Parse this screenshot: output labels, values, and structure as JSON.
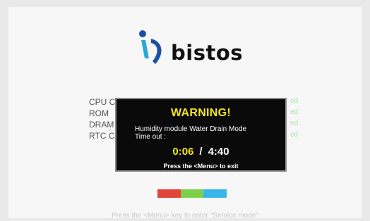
{
  "logo": {
    "brand": "bistos",
    "mark_colors": {
      "primary": "#1b4fa8",
      "accent": "#2aa8d6"
    }
  },
  "boot_checks": [
    {
      "label": "CPU C",
      "status": "ed"
    },
    {
      "label": "ROM",
      "status": "ed"
    },
    {
      "label": "DRAM",
      "status": "ed"
    },
    {
      "label": "RTC C",
      "status": "ed"
    }
  ],
  "warning": {
    "title": "WARNING!",
    "line1": "Humidity module Water Drain Mode",
    "line2": "Time out :",
    "elapsed": "0:06",
    "separator": "/",
    "total": "4:40",
    "exit_hint": "Press the <Menu> to exit"
  },
  "progress": {
    "segment_colors": [
      "#e2433a",
      "#7ed04a",
      "#39b6e8"
    ]
  },
  "hint": "Press the <Menu> key to enter \"Service mode\""
}
